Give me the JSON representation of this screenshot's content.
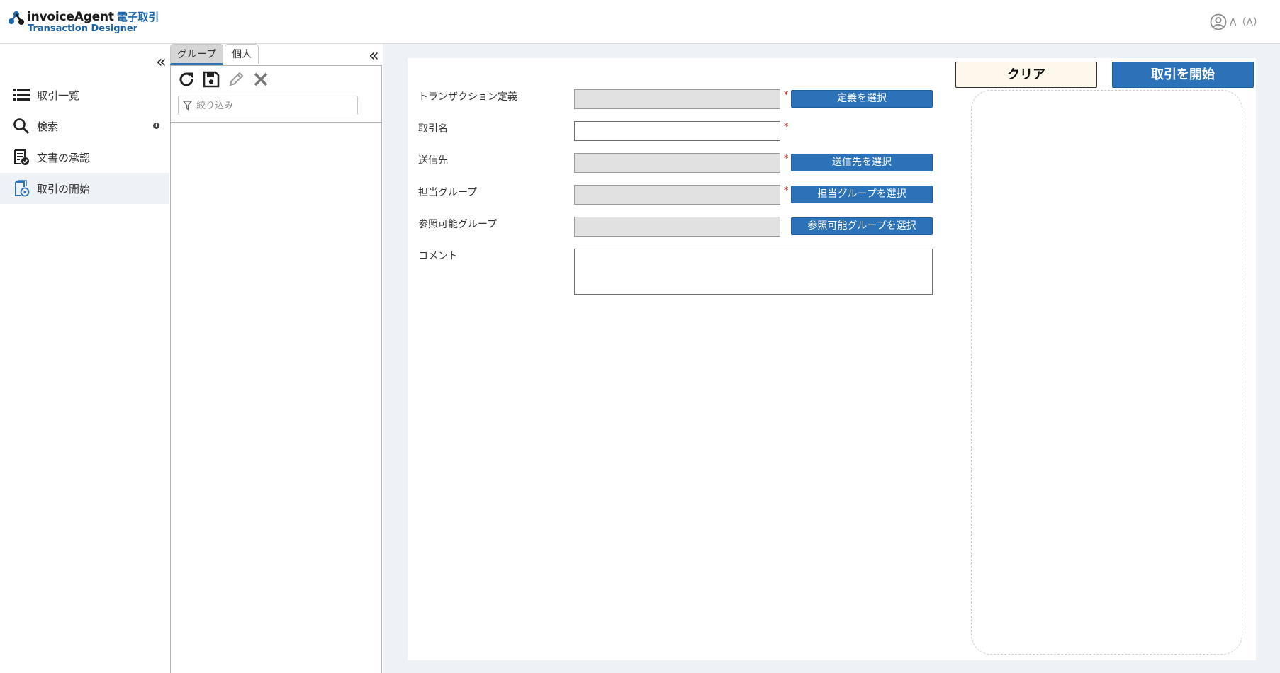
{
  "header": {
    "logo_title": "invoiceAgent",
    "logo_title_jp": "電子取引",
    "logo_subtitle": "Transaction Designer",
    "user_label": "A（A）"
  },
  "sidebar": {
    "items": [
      {
        "label": "取引一覧",
        "icon": "list-icon"
      },
      {
        "label": "検索",
        "icon": "search-icon"
      },
      {
        "label": "文書の承認",
        "icon": "document-approve-icon"
      },
      {
        "label": "取引の開始",
        "icon": "transaction-start-icon",
        "active": true
      }
    ]
  },
  "middle_panel": {
    "tabs": [
      {
        "label": "グループ",
        "active": true
      },
      {
        "label": "個人",
        "active": false
      }
    ],
    "filter_placeholder": "絞り込み"
  },
  "form": {
    "rows": [
      {
        "label": "トランザクション定義",
        "value": "",
        "required": true,
        "button": "定義を選択"
      },
      {
        "label": "取引名",
        "value": "",
        "required": true,
        "button": ""
      },
      {
        "label": "送信先",
        "value": "",
        "required": true,
        "button": "送信先を選択"
      },
      {
        "label": "担当グループ",
        "value": "",
        "required": true,
        "button": "担当グループを選択"
      },
      {
        "label": "参照可能グループ",
        "value": "",
        "required": false,
        "button": "参照可能グループを選択"
      }
    ],
    "comment_label": "コメント",
    "comment_value": "",
    "required_mark": "*"
  },
  "actions": {
    "clear_label": "クリア",
    "start_label": "取引を開始"
  },
  "colors": {
    "primary": "#2b72b8",
    "brand_blue": "#1a63a7",
    "required": "#dd2222",
    "main_bg": "#eef2f7"
  }
}
